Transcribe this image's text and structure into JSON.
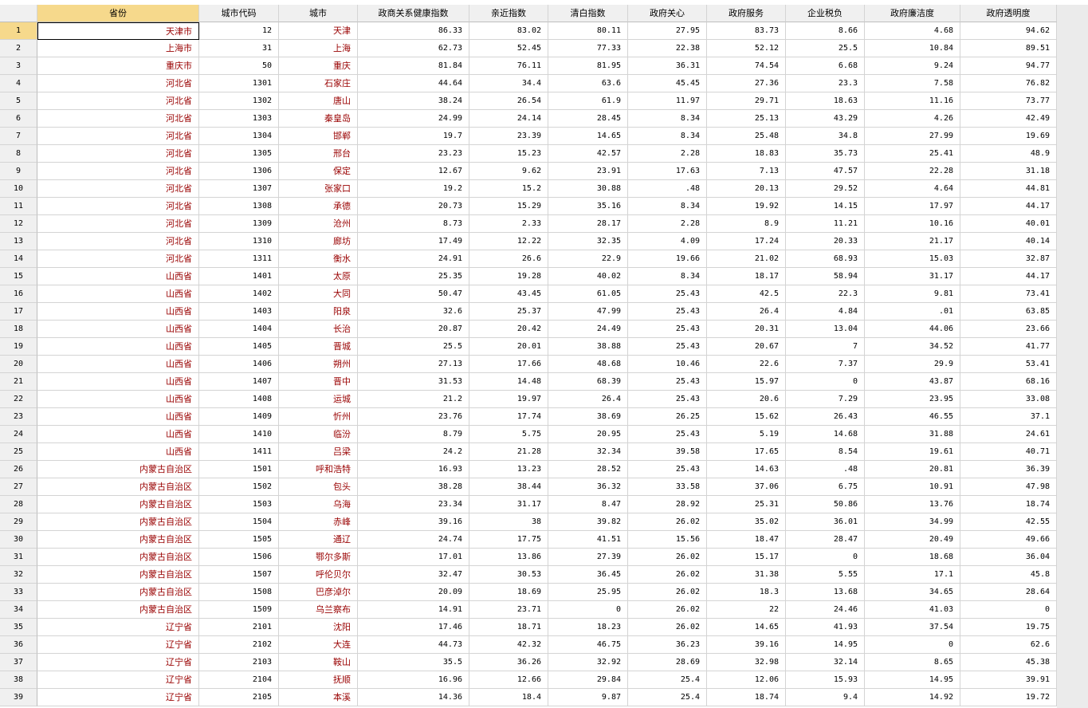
{
  "columns": [
    "省份",
    "城市代码",
    "城市",
    "政商关系健康指数",
    "亲近指数",
    "清白指数",
    "政府关心",
    "政府服务",
    "企业税负",
    "政府廉洁度",
    "政府透明度"
  ],
  "rows": [
    [
      "1",
      "天津市",
      "12",
      "天津",
      "86.33",
      "83.02",
      "80.11",
      "27.95",
      "83.73",
      "8.66",
      "4.68",
      "94.62"
    ],
    [
      "2",
      "上海市",
      "31",
      "上海",
      "62.73",
      "52.45",
      "77.33",
      "22.38",
      "52.12",
      "25.5",
      "10.84",
      "89.51"
    ],
    [
      "3",
      "重庆市",
      "50",
      "重庆",
      "81.84",
      "76.11",
      "81.95",
      "36.31",
      "74.54",
      "6.68",
      "9.24",
      "94.77"
    ],
    [
      "4",
      "河北省",
      "1301",
      "石家庄",
      "44.64",
      "34.4",
      "63.6",
      "45.45",
      "27.36",
      "23.3",
      "7.58",
      "76.82"
    ],
    [
      "5",
      "河北省",
      "1302",
      "唐山",
      "38.24",
      "26.54",
      "61.9",
      "11.97",
      "29.71",
      "18.63",
      "11.16",
      "73.77"
    ],
    [
      "6",
      "河北省",
      "1303",
      "秦皇岛",
      "24.99",
      "24.14",
      "28.45",
      "8.34",
      "25.13",
      "43.29",
      "4.26",
      "42.49"
    ],
    [
      "7",
      "河北省",
      "1304",
      "邯郸",
      "19.7",
      "23.39",
      "14.65",
      "8.34",
      "25.48",
      "34.8",
      "27.99",
      "19.69"
    ],
    [
      "8",
      "河北省",
      "1305",
      "邢台",
      "23.23",
      "15.23",
      "42.57",
      "2.28",
      "18.83",
      "35.73",
      "25.41",
      "48.9"
    ],
    [
      "9",
      "河北省",
      "1306",
      "保定",
      "12.67",
      "9.62",
      "23.91",
      "17.63",
      "7.13",
      "47.57",
      "22.28",
      "31.18"
    ],
    [
      "10",
      "河北省",
      "1307",
      "张家口",
      "19.2",
      "15.2",
      "30.88",
      ".48",
      "20.13",
      "29.52",
      "4.64",
      "44.81"
    ],
    [
      "11",
      "河北省",
      "1308",
      "承德",
      "20.73",
      "15.29",
      "35.16",
      "8.34",
      "19.92",
      "14.15",
      "17.97",
      "44.17"
    ],
    [
      "12",
      "河北省",
      "1309",
      "沧州",
      "8.73",
      "2.33",
      "28.17",
      "2.28",
      "8.9",
      "11.21",
      "10.16",
      "40.01"
    ],
    [
      "13",
      "河北省",
      "1310",
      "廊坊",
      "17.49",
      "12.22",
      "32.35",
      "4.09",
      "17.24",
      "20.33",
      "21.17",
      "40.14"
    ],
    [
      "14",
      "河北省",
      "1311",
      "衡水",
      "24.91",
      "26.6",
      "22.9",
      "19.66",
      "21.02",
      "68.93",
      "15.03",
      "32.87"
    ],
    [
      "15",
      "山西省",
      "1401",
      "太原",
      "25.35",
      "19.28",
      "40.02",
      "8.34",
      "18.17",
      "58.94",
      "31.17",
      "44.17"
    ],
    [
      "16",
      "山西省",
      "1402",
      "大同",
      "50.47",
      "43.45",
      "61.05",
      "25.43",
      "42.5",
      "22.3",
      "9.81",
      "73.41"
    ],
    [
      "17",
      "山西省",
      "1403",
      "阳泉",
      "32.6",
      "25.37",
      "47.99",
      "25.43",
      "26.4",
      "4.84",
      ".01",
      "63.85"
    ],
    [
      "18",
      "山西省",
      "1404",
      "长治",
      "20.87",
      "20.42",
      "24.49",
      "25.43",
      "20.31",
      "13.04",
      "44.06",
      "23.66"
    ],
    [
      "19",
      "山西省",
      "1405",
      "晋城",
      "25.5",
      "20.01",
      "38.88",
      "25.43",
      "20.67",
      "7",
      "34.52",
      "41.77"
    ],
    [
      "20",
      "山西省",
      "1406",
      "朔州",
      "27.13",
      "17.66",
      "48.68",
      "10.46",
      "22.6",
      "7.37",
      "29.9",
      "53.41"
    ],
    [
      "21",
      "山西省",
      "1407",
      "晋中",
      "31.53",
      "14.48",
      "68.39",
      "25.43",
      "15.97",
      "0",
      "43.87",
      "68.16"
    ],
    [
      "22",
      "山西省",
      "1408",
      "运城",
      "21.2",
      "19.97",
      "26.4",
      "25.43",
      "20.6",
      "7.29",
      "23.95",
      "33.08"
    ],
    [
      "23",
      "山西省",
      "1409",
      "忻州",
      "23.76",
      "17.74",
      "38.69",
      "26.25",
      "15.62",
      "26.43",
      "46.55",
      "37.1"
    ],
    [
      "24",
      "山西省",
      "1410",
      "临汾",
      "8.79",
      "5.75",
      "20.95",
      "25.43",
      "5.19",
      "14.68",
      "31.88",
      "24.61"
    ],
    [
      "25",
      "山西省",
      "1411",
      "吕梁",
      "24.2",
      "21.28",
      "32.34",
      "39.58",
      "17.65",
      "8.54",
      "19.61",
      "40.71"
    ],
    [
      "26",
      "内蒙古自治区",
      "1501",
      "呼和浩特",
      "16.93",
      "13.23",
      "28.52",
      "25.43",
      "14.63",
      ".48",
      "20.81",
      "36.39"
    ],
    [
      "27",
      "内蒙古自治区",
      "1502",
      "包头",
      "38.28",
      "38.44",
      "36.32",
      "33.58",
      "37.06",
      "6.75",
      "10.91",
      "47.98"
    ],
    [
      "28",
      "内蒙古自治区",
      "1503",
      "乌海",
      "23.34",
      "31.17",
      "8.47",
      "28.92",
      "25.31",
      "50.86",
      "13.76",
      "18.74"
    ],
    [
      "29",
      "内蒙古自治区",
      "1504",
      "赤峰",
      "39.16",
      "38",
      "39.82",
      "26.02",
      "35.02",
      "36.01",
      "34.99",
      "42.55"
    ],
    [
      "30",
      "内蒙古自治区",
      "1505",
      "通辽",
      "24.74",
      "17.75",
      "41.51",
      "15.56",
      "18.47",
      "28.47",
      "20.49",
      "49.66"
    ],
    [
      "31",
      "内蒙古自治区",
      "1506",
      "鄂尔多斯",
      "17.01",
      "13.86",
      "27.39",
      "26.02",
      "15.17",
      "0",
      "18.68",
      "36.04"
    ],
    [
      "32",
      "内蒙古自治区",
      "1507",
      "呼伦贝尔",
      "32.47",
      "30.53",
      "36.45",
      "26.02",
      "31.38",
      "5.55",
      "17.1",
      "45.8"
    ],
    [
      "33",
      "内蒙古自治区",
      "1508",
      "巴彦淖尔",
      "20.09",
      "18.69",
      "25.95",
      "26.02",
      "18.3",
      "13.68",
      "34.65",
      "28.64"
    ],
    [
      "34",
      "内蒙古自治区",
      "1509",
      "乌兰察布",
      "14.91",
      "23.71",
      "0",
      "26.02",
      "22",
      "24.46",
      "41.03",
      "0"
    ],
    [
      "35",
      "辽宁省",
      "2101",
      "沈阳",
      "17.46",
      "18.71",
      "18.23",
      "26.02",
      "14.65",
      "41.93",
      "37.54",
      "19.75"
    ],
    [
      "36",
      "辽宁省",
      "2102",
      "大连",
      "44.73",
      "42.32",
      "46.75",
      "36.23",
      "39.16",
      "14.95",
      "0",
      "62.6"
    ],
    [
      "37",
      "辽宁省",
      "2103",
      "鞍山",
      "35.5",
      "36.26",
      "32.92",
      "28.69",
      "32.98",
      "32.14",
      "8.65",
      "45.38"
    ],
    [
      "38",
      "辽宁省",
      "2104",
      "抚顺",
      "16.96",
      "12.66",
      "29.84",
      "25.4",
      "12.06",
      "15.93",
      "14.95",
      "39.91"
    ],
    [
      "39",
      "辽宁省",
      "2105",
      "本溪",
      "14.36",
      "18.4",
      "9.87",
      "25.4",
      "18.74",
      "9.4",
      "14.92",
      "19.72"
    ]
  ]
}
